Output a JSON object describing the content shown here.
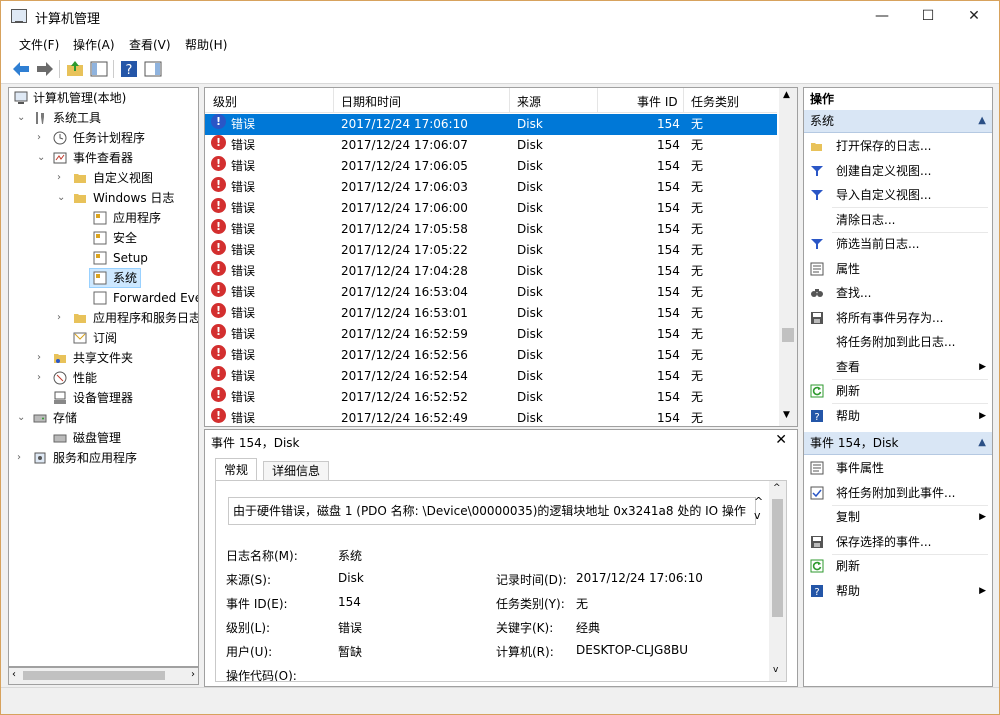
{
  "window": {
    "title": "计算机管理",
    "minimize_glyph": "—",
    "maximize_glyph": "☐",
    "close_glyph": "✕"
  },
  "menu": [
    "文件(F)",
    "操作(A)",
    "查看(V)",
    "帮助(H)"
  ],
  "tree": {
    "root": "计算机管理(本地)",
    "system_tools": "系统工具",
    "task_scheduler": "任务计划程序",
    "event_viewer": "事件查看器",
    "custom_views": "自定义视图",
    "windows_logs": "Windows 日志",
    "application": "应用程序",
    "security": "安全",
    "setup": "Setup",
    "system": "系统",
    "forwarded": "Forwarded Eve",
    "app_service_logs": "应用程序和服务日志",
    "subscriptions": "订阅",
    "shared_folders": "共享文件夹",
    "performance": "性能",
    "device_manager": "设备管理器",
    "storage": "存储",
    "disk_management": "磁盘管理",
    "services_apps": "服务和应用程序"
  },
  "events": {
    "columns": [
      "级别",
      "日期和时间",
      "来源",
      "事件 ID",
      "任务类别"
    ],
    "rows": [
      {
        "level": "错误",
        "datetime": "2017/12/24 17:06:10",
        "source": "Disk",
        "id": "154",
        "task": "无"
      },
      {
        "level": "错误",
        "datetime": "2017/12/24 17:06:07",
        "source": "Disk",
        "id": "154",
        "task": "无"
      },
      {
        "level": "错误",
        "datetime": "2017/12/24 17:06:05",
        "source": "Disk",
        "id": "154",
        "task": "无"
      },
      {
        "level": "错误",
        "datetime": "2017/12/24 17:06:03",
        "source": "Disk",
        "id": "154",
        "task": "无"
      },
      {
        "level": "错误",
        "datetime": "2017/12/24 17:06:00",
        "source": "Disk",
        "id": "154",
        "task": "无"
      },
      {
        "level": "错误",
        "datetime": "2017/12/24 17:05:58",
        "source": "Disk",
        "id": "154",
        "task": "无"
      },
      {
        "level": "错误",
        "datetime": "2017/12/24 17:05:22",
        "source": "Disk",
        "id": "154",
        "task": "无"
      },
      {
        "level": "错误",
        "datetime": "2017/12/24 17:04:28",
        "source": "Disk",
        "id": "154",
        "task": "无"
      },
      {
        "level": "错误",
        "datetime": "2017/12/24 16:53:04",
        "source": "Disk",
        "id": "154",
        "task": "无"
      },
      {
        "level": "错误",
        "datetime": "2017/12/24 16:53:01",
        "source": "Disk",
        "id": "154",
        "task": "无"
      },
      {
        "level": "错误",
        "datetime": "2017/12/24 16:52:59",
        "source": "Disk",
        "id": "154",
        "task": "无"
      },
      {
        "level": "错误",
        "datetime": "2017/12/24 16:52:56",
        "source": "Disk",
        "id": "154",
        "task": "无"
      },
      {
        "level": "错误",
        "datetime": "2017/12/24 16:52:54",
        "source": "Disk",
        "id": "154",
        "task": "无"
      },
      {
        "level": "错误",
        "datetime": "2017/12/24 16:52:52",
        "source": "Disk",
        "id": "154",
        "task": "无"
      },
      {
        "level": "错误",
        "datetime": "2017/12/24 16:52:49",
        "source": "Disk",
        "id": "154",
        "task": "无"
      }
    ]
  },
  "detail": {
    "title": "事件 154，Disk",
    "tab_general": "常规",
    "tab_details": "详细信息",
    "message": "由于硬件错误，磁盘 1 (PDO 名称: \\Device\\00000035)的逻辑块地址 0x3241a8 处的 IO 操作",
    "log_name_label": "日志名称(M):",
    "log_name": "系统",
    "source_label": "来源(S):",
    "source": "Disk",
    "logged_label": "记录时间(D):",
    "logged": "2017/12/24 17:06:10",
    "event_id_label": "事件 ID(E):",
    "event_id": "154",
    "task_label": "任务类别(Y):",
    "task": "无",
    "level_label": "级别(L):",
    "level": "错误",
    "keywords_label": "关键字(K):",
    "keywords": "经典",
    "user_label": "用户(U):",
    "user": "暂缺",
    "computer_label": "计算机(R):",
    "computer": "DESKTOP-CLJG8BU",
    "opcode_label": "操作代码(O):"
  },
  "actions": {
    "header": "操作",
    "section1": "系统",
    "items1": [
      "打开保存的日志...",
      "创建自定义视图...",
      "导入自定义视图...",
      "清除日志...",
      "筛选当前日志...",
      "属性",
      "查找...",
      "将所有事件另存为...",
      "将任务附加到此日志...",
      "查看",
      "刷新",
      "帮助"
    ],
    "section2": "事件 154，Disk",
    "items2": [
      "事件属性",
      "将任务附加到此事件...",
      "复制",
      "保存选择的事件...",
      "刷新",
      "帮助"
    ]
  },
  "colors": {
    "selection": "#0078d7",
    "error": "#d32f2f",
    "section_bg": "#d9e6f5"
  }
}
